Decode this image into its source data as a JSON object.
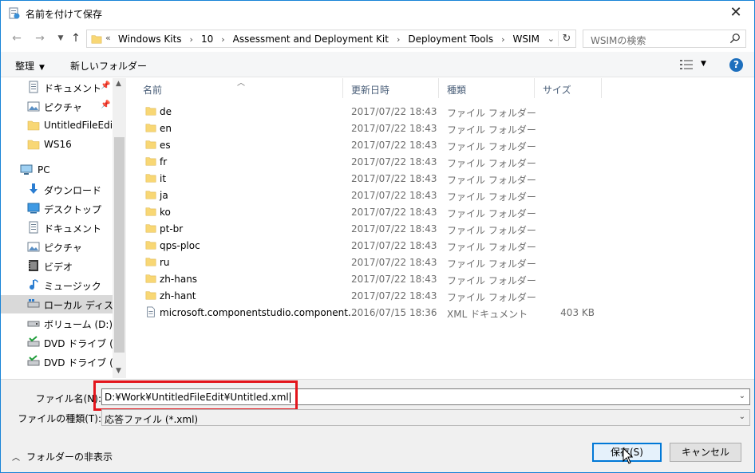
{
  "window": {
    "title": "名前を付けて保存",
    "close": "✕"
  },
  "nav": {
    "address_chevron": "«",
    "breadcrumbs": [
      "Windows Kits",
      "10",
      "Assessment and Deployment Kit",
      "Deployment Tools",
      "WSIM"
    ],
    "search_placeholder": "WSIMの検索"
  },
  "toolbar": {
    "organize": "整理",
    "new_folder": "新しいフォルダー"
  },
  "sidebar": {
    "items": [
      {
        "label": "ドキュメント",
        "icon": "documents-icon",
        "pinned": true
      },
      {
        "label": "ピクチャ",
        "icon": "pictures-icon",
        "pinned": true
      },
      {
        "label": "UntitledFileEdit",
        "icon": "folder-icon",
        "pinned": false
      },
      {
        "label": "WS16",
        "icon": "folder-icon",
        "pinned": false
      },
      {
        "label": "PC",
        "icon": "pc-icon",
        "pinned": false
      },
      {
        "label": "ダウンロード",
        "icon": "download-icon",
        "pinned": false
      },
      {
        "label": "デスクトップ",
        "icon": "desktop-icon",
        "pinned": false
      },
      {
        "label": "ドキュメント",
        "icon": "documents-icon",
        "pinned": false
      },
      {
        "label": "ピクチャ",
        "icon": "pictures-icon",
        "pinned": false
      },
      {
        "label": "ビデオ",
        "icon": "video-icon",
        "pinned": false
      },
      {
        "label": "ミュージック",
        "icon": "music-icon",
        "pinned": false
      },
      {
        "label": "ローカル ディスク (C",
        "icon": "local-disk-icon",
        "pinned": false
      },
      {
        "label": "ボリューム (D:)",
        "icon": "drive-icon",
        "pinned": false
      },
      {
        "label": "DVD ドライブ (E:) S",
        "icon": "dvd-drive-icon",
        "pinned": false
      },
      {
        "label": "DVD ドライブ (F:) S",
        "icon": "dvd-drive-icon",
        "pinned": false
      }
    ]
  },
  "columns": {
    "name": "名前",
    "date": "更新日時",
    "type": "種類",
    "size": "サイズ"
  },
  "files": [
    {
      "name": "de",
      "date": "2017/07/22 18:43",
      "type": "ファイル フォルダー",
      "size": "",
      "icon": "folder-icon"
    },
    {
      "name": "en",
      "date": "2017/07/22 18:43",
      "type": "ファイル フォルダー",
      "size": "",
      "icon": "folder-icon"
    },
    {
      "name": "es",
      "date": "2017/07/22 18:43",
      "type": "ファイル フォルダー",
      "size": "",
      "icon": "folder-icon"
    },
    {
      "name": "fr",
      "date": "2017/07/22 18:43",
      "type": "ファイル フォルダー",
      "size": "",
      "icon": "folder-icon"
    },
    {
      "name": "it",
      "date": "2017/07/22 18:43",
      "type": "ファイル フォルダー",
      "size": "",
      "icon": "folder-icon"
    },
    {
      "name": "ja",
      "date": "2017/07/22 18:43",
      "type": "ファイル フォルダー",
      "size": "",
      "icon": "folder-icon"
    },
    {
      "name": "ko",
      "date": "2017/07/22 18:43",
      "type": "ファイル フォルダー",
      "size": "",
      "icon": "folder-icon"
    },
    {
      "name": "pt-br",
      "date": "2017/07/22 18:43",
      "type": "ファイル フォルダー",
      "size": "",
      "icon": "folder-icon"
    },
    {
      "name": "qps-ploc",
      "date": "2017/07/22 18:43",
      "type": "ファイル フォルダー",
      "size": "",
      "icon": "folder-icon"
    },
    {
      "name": "ru",
      "date": "2017/07/22 18:43",
      "type": "ファイル フォルダー",
      "size": "",
      "icon": "folder-icon"
    },
    {
      "name": "zh-hans",
      "date": "2017/07/22 18:43",
      "type": "ファイル フォルダー",
      "size": "",
      "icon": "folder-icon"
    },
    {
      "name": "zh-hant",
      "date": "2017/07/22 18:43",
      "type": "ファイル フォルダー",
      "size": "",
      "icon": "folder-icon"
    },
    {
      "name": "microsoft.componentstudio.component...",
      "date": "2016/07/15 18:36",
      "type": "XML ドキュメント",
      "size": "403 KB",
      "icon": "xml-file-icon"
    }
  ],
  "form": {
    "filename_label": "ファイル名(N):",
    "filename_value": "D:¥Work¥UntitledFileEdit¥Untitled.xml",
    "filetype_label": "ファイルの種類(T):",
    "filetype_value": "応答ファイル (*.xml)"
  },
  "footer": {
    "hide_folders": "フォルダーの非表示",
    "save": "保存(S)",
    "cancel": "キャンセル"
  },
  "colors": {
    "accent": "#0078d7",
    "folder": "#f8d775",
    "highlight": "#e3151c",
    "help": "#1d6fbd"
  }
}
